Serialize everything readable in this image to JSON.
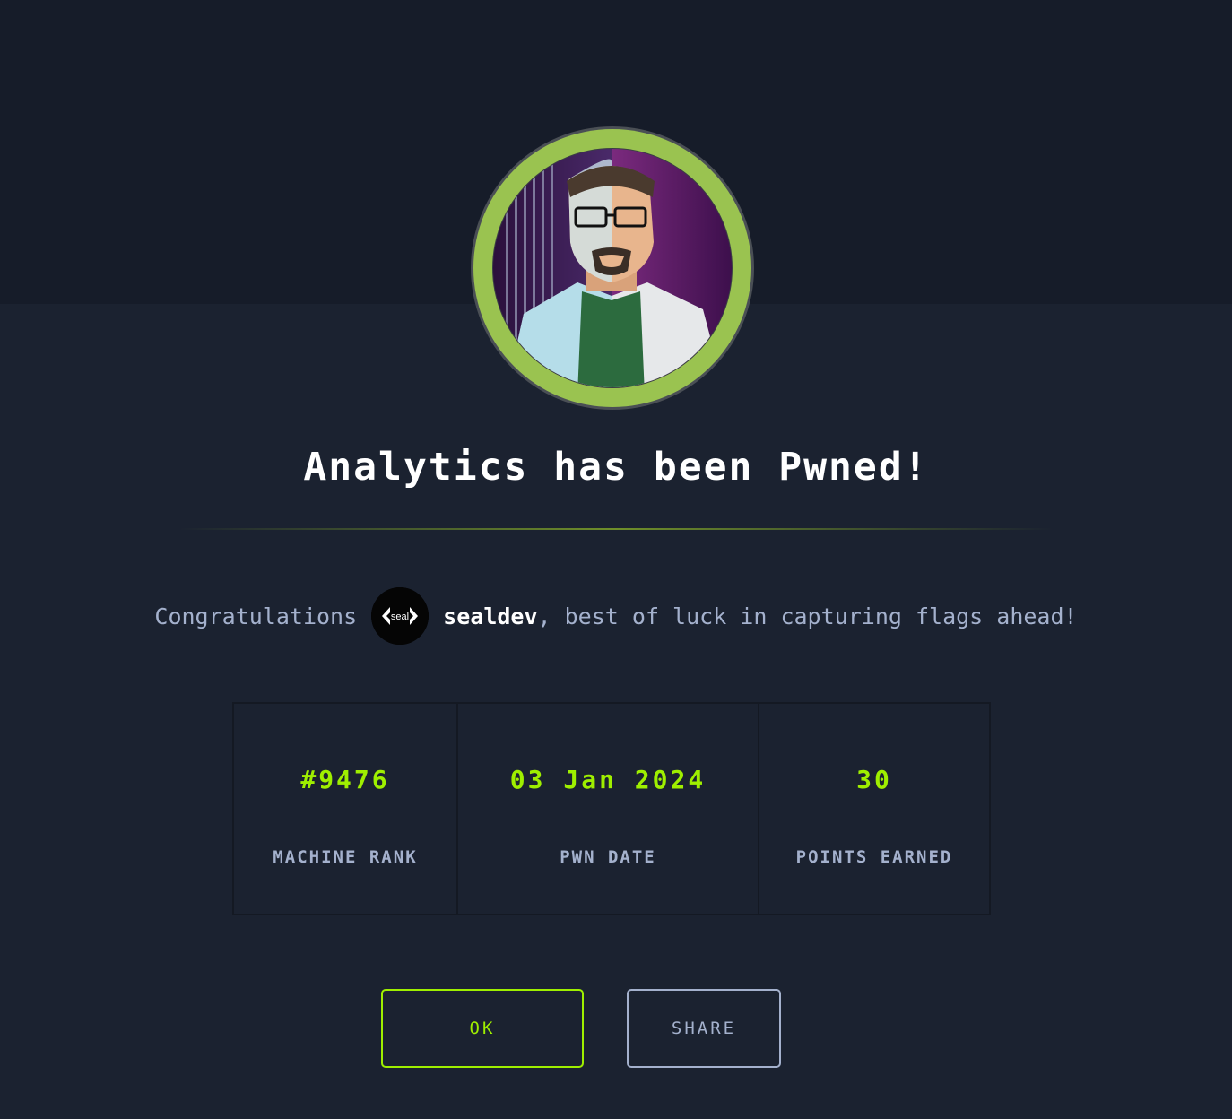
{
  "dialog": {
    "title": "Analytics has been Pwned!",
    "congrats_prefix": "Congratulations",
    "username": "sealdev",
    "congrats_suffix": ", best of luck in capturing flags ahead!",
    "user_avatar_text": "seal"
  },
  "stats": [
    {
      "value": "#9476",
      "label": "MACHINE RANK"
    },
    {
      "value": "03 Jan 2024",
      "label": "PWN DATE"
    },
    {
      "value": "30",
      "label": "POINTS EARNED"
    }
  ],
  "buttons": {
    "ok": "OK",
    "share": "SHARE"
  },
  "colors": {
    "accent": "#9fef00",
    "background": "#1b2230",
    "muted_text": "#a4b1cd"
  },
  "icons": {
    "machine_avatar": "analytics-machine-avatar",
    "user_avatar": "sealdev-avatar"
  }
}
